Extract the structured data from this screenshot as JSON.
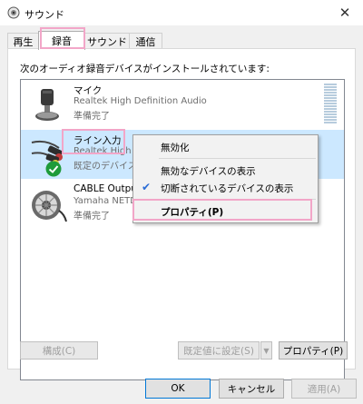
{
  "window": {
    "title": "サウンド"
  },
  "tabs": [
    {
      "label": "再生"
    },
    {
      "label": "録音"
    },
    {
      "label": "サウンド"
    },
    {
      "label": "通信"
    }
  ],
  "panel": {
    "description": "次のオーディオ録音デバイスがインストールされています:"
  },
  "devices": [
    {
      "name": "マイク",
      "driver": "Realtek High Definition Audio",
      "status": "準備完了"
    },
    {
      "name": "ライン入力",
      "driver": "Realtek High D",
      "status": "既定のデバイス"
    },
    {
      "name": "CABLE Output",
      "driver": "Yamaha NETDU",
      "status": "準備完了"
    }
  ],
  "context_menu": {
    "disable": "無効化",
    "show_disabled": "無効なデバイスの表示",
    "show_disconnected": "切断されているデバイスの表示",
    "properties": "プロパティ(P)"
  },
  "panel_buttons": {
    "configure": "構成(C)",
    "set_default": "既定値に設定(S)",
    "properties": "プロパティ(P)"
  },
  "dialog_buttons": {
    "ok": "OK",
    "cancel": "キャンセル",
    "apply": "適用(A)"
  },
  "colors": {
    "selection": "#cce8ff",
    "highlight": "#f2a6c8",
    "check": "#2a6cd6",
    "default_badge": "#1e9b3a"
  }
}
